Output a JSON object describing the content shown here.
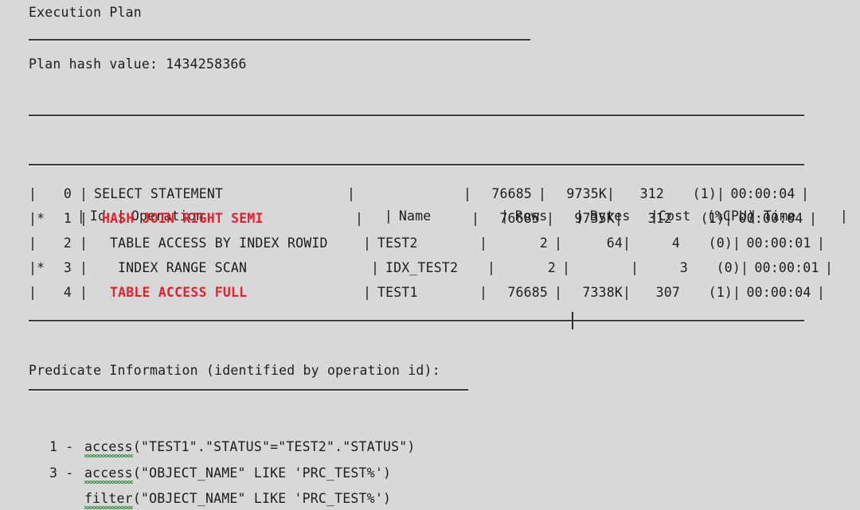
{
  "document": {
    "title": "Execution Plan",
    "plan_hash_label": "Plan hash value: 1434258366",
    "predicate_heading": "Predicate Information (identified by operation id):"
  },
  "colors": {
    "background": "#d8d8da",
    "text": "#1d1d1d",
    "rule": "#3a3a3a",
    "highlight_red": "#e2222a",
    "spellcheck_green": "#3a8f3a"
  },
  "table": {
    "headers": {
      "id": "Id",
      "operation": "Operation",
      "name": "Name",
      "rows": "Rows",
      "bytes": "Bytes",
      "cost": "Cost  (%CPU)",
      "time": "Time"
    },
    "rows": [
      {
        "flag": "|",
        "id": "0",
        "operation": "SELECT STATEMENT",
        "operation_indent": 0,
        "highlight": false,
        "name": "",
        "rows": "76685",
        "bytes": "9735K",
        "cost": "312",
        "cpu": "(1)",
        "time": "00:00:04"
      },
      {
        "flag": "|*",
        "id": "1",
        "operation": "HASH JOIN RIGHT SEMI",
        "operation_indent": 1,
        "highlight": true,
        "name": "",
        "rows": "76685",
        "bytes": "9735K",
        "cost": "312",
        "cpu": "(1)",
        "time": "00:00:04"
      },
      {
        "flag": "|",
        "id": "2",
        "operation": "TABLE ACCESS BY INDEX ROWID",
        "operation_indent": 2,
        "highlight": false,
        "name": "TEST2",
        "rows": "2",
        "bytes": "64",
        "cost": "4",
        "cpu": "(0)",
        "time": "00:00:01"
      },
      {
        "flag": "|*",
        "id": "3",
        "operation": "INDEX RANGE SCAN",
        "operation_indent": 3,
        "highlight": false,
        "name": "IDX_TEST2",
        "rows": "2",
        "bytes": "",
        "cost": "3",
        "cpu": "(0)",
        "time": "00:00:01"
      },
      {
        "flag": "|",
        "id": "4",
        "operation": "TABLE ACCESS FULL",
        "operation_indent": 2,
        "highlight": true,
        "name": "TEST1",
        "rows": "76685",
        "bytes": "7338K",
        "cost": "307",
        "cpu": "(1)",
        "time": "00:00:04"
      }
    ]
  },
  "predicates": [
    {
      "id": "1",
      "dash": "-",
      "keyword": "access",
      "expression": "(\"TEST1\".\"STATUS\"=\"TEST2\".\"STATUS\")"
    },
    {
      "id": "3",
      "dash": "-",
      "keyword": "access",
      "expression": "(\"OBJECT_NAME\" LIKE 'PRC_TEST%')"
    },
    {
      "id": "",
      "dash": "",
      "keyword": "filter",
      "expression": "(\"OBJECT_NAME\" LIKE 'PRC_TEST%')"
    }
  ]
}
